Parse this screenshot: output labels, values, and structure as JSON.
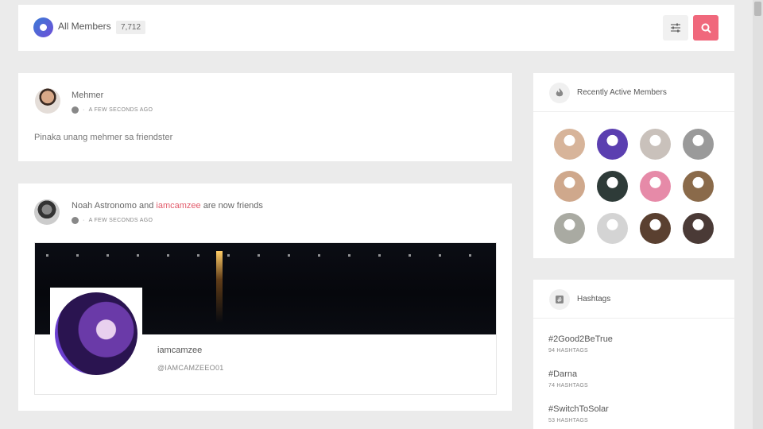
{
  "header": {
    "title": "All Members",
    "count": "7,712",
    "filter_icon": "sliders-icon",
    "search_icon": "search-icon",
    "accent": "#f0687c"
  },
  "feed": [
    {
      "author": "Mehmer",
      "time": "A FEW SECONDS AGO",
      "text": "Pinaka unang mehmer sa friendster"
    },
    {
      "author": "Noah Astronomo",
      "connector": " and ",
      "friend": "iamcamzee",
      "suffix": " are now friends",
      "time": "A FEW SECONDS AGO",
      "profile": {
        "name": "iamcamzee",
        "handle": "@IAMCAMZEEO01"
      }
    }
  ],
  "sidebar": {
    "recent": {
      "title": "Recently Active Members",
      "icon": "flame-icon",
      "members": [
        {
          "color": "#d7b49a"
        },
        {
          "color": "#5b3fb0"
        },
        {
          "color": "#c9c1bb"
        },
        {
          "color": "#9a9a9a"
        },
        {
          "color": "#cfa88c"
        },
        {
          "color": "#2e3b38"
        },
        {
          "color": "#e68aa8"
        },
        {
          "color": "#8a6a4a"
        },
        {
          "color": "#a9aaa2"
        },
        {
          "color": "#d4d4d4"
        },
        {
          "color": "#5a4030"
        },
        {
          "color": "#4a3a36"
        }
      ]
    },
    "hashtags": {
      "title": "Hashtags",
      "icon": "hashtag-icon",
      "items": [
        {
          "tag": "#2Good2BeTrue",
          "count": "94 HASHTAGS"
        },
        {
          "tag": "#Darna",
          "count": "74 HASHTAGS"
        },
        {
          "tag": "#SwitchToSolar",
          "count": "53 HASHTAGS"
        }
      ]
    }
  }
}
